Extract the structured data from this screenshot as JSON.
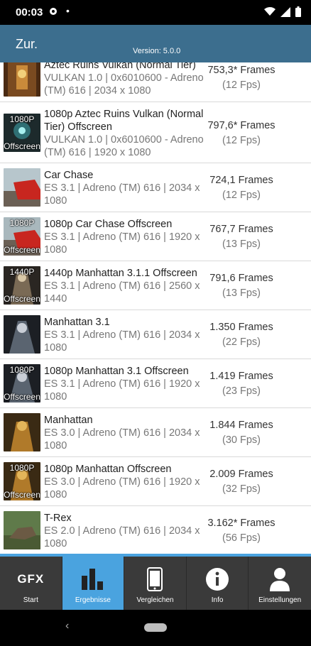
{
  "status_bar": {
    "time": "00:03",
    "icons": [
      "settings-icon",
      "notification-dot",
      "wifi-icon",
      "signal-icon",
      "battery-icon"
    ]
  },
  "app_bar": {
    "title": "Zur.",
    "version": "Version: 5.0.0"
  },
  "results": [
    {
      "name": "Aztec Ruins Vulkan (Normal Tier)",
      "details": "VULKAN 1.0 | 0x6010600 - Adreno (TM) 616 | 2034 x 1080",
      "frames": "753,3* Frames",
      "fps": "(12 Fps)",
      "overlay_top": "",
      "overlay_bottom": ""
    },
    {
      "name": "1080p Aztec Ruins Vulkan (Normal Tier) Offscreen",
      "details": "VULKAN 1.0 | 0x6010600 - Adreno (TM) 616 | 1920 x 1080",
      "frames": "797,6* Frames",
      "fps": "(12 Fps)",
      "overlay_top": "1080P",
      "overlay_bottom": "Offscreen"
    },
    {
      "name": "Car Chase",
      "details": "ES 3.1 | Adreno (TM) 616 | 2034 x 1080",
      "frames": "724,1 Frames",
      "fps": "(12 Fps)",
      "overlay_top": "",
      "overlay_bottom": ""
    },
    {
      "name": "1080p Car Chase Offscreen",
      "details": "ES 3.1 | Adreno (TM) 616 | 1920 x 1080",
      "frames": "767,7 Frames",
      "fps": "(13 Fps)",
      "overlay_top": "1080P",
      "overlay_bottom": "Offscreen"
    },
    {
      "name": "1440p Manhattan 3.1.1 Offscreen",
      "details": "ES 3.1 | Adreno (TM) 616 | 2560 x 1440",
      "frames": "791,6 Frames",
      "fps": "(13 Fps)",
      "overlay_top": "1440P",
      "overlay_bottom": "Offscreen"
    },
    {
      "name": "Manhattan 3.1",
      "details": "ES 3.1 | Adreno (TM) 616 | 2034 x 1080",
      "frames": "1.350 Frames",
      "fps": "(22 Fps)",
      "overlay_top": "",
      "overlay_bottom": ""
    },
    {
      "name": "1080p Manhattan 3.1 Offscreen",
      "details": "ES 3.1 | Adreno (TM) 616 | 1920 x 1080",
      "frames": "1.419 Frames",
      "fps": "(23 Fps)",
      "overlay_top": "1080P",
      "overlay_bottom": "Offscreen"
    },
    {
      "name": "Manhattan",
      "details": "ES 3.0 | Adreno (TM) 616 | 2034 x 1080",
      "frames": "1.844 Frames",
      "fps": "(30 Fps)",
      "overlay_top": "",
      "overlay_bottom": ""
    },
    {
      "name": "1080p Manhattan Offscreen",
      "details": "ES 3.0 | Adreno (TM) 616 | 1920 x 1080",
      "frames": "2.009 Frames",
      "fps": "(32 Fps)",
      "overlay_top": "1080P",
      "overlay_bottom": "Offscreen"
    },
    {
      "name": "T-Rex",
      "details": "ES 2.0 | Adreno (TM) 616 | 2034 x 1080",
      "frames": "3.162* Frames",
      "fps": "(56 Fps)",
      "overlay_top": "",
      "overlay_bottom": ""
    }
  ],
  "bottom_nav": [
    {
      "label": "Start",
      "icon": "gfx-logo-icon",
      "logo_text": "GFX",
      "active": false
    },
    {
      "label": "Ergebnisse",
      "icon": "bar-chart-icon",
      "active": true
    },
    {
      "label": "Vergleichen",
      "icon": "phone-icon",
      "active": false
    },
    {
      "label": "Info",
      "icon": "info-icon",
      "active": false
    },
    {
      "label": "Einstellungen",
      "icon": "person-icon",
      "active": false
    }
  ],
  "colors": {
    "app_bar": "#3c6e8e",
    "accent": "#4aa3df",
    "nav_bg": "#3a3a3a"
  }
}
